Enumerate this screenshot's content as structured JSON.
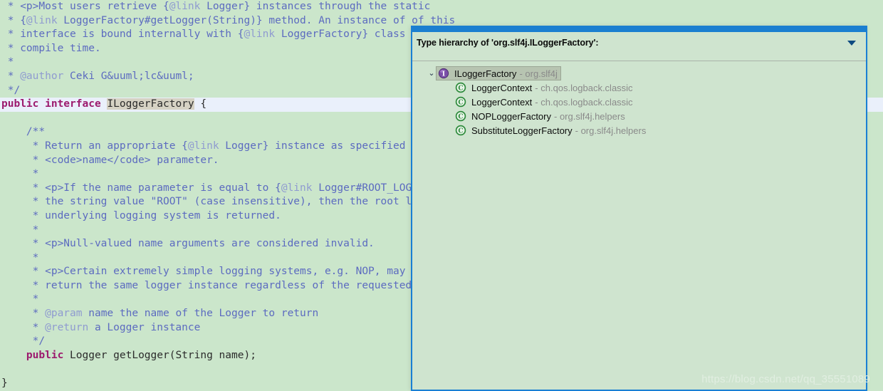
{
  "colors": {
    "editor_background": "#cbe6cb",
    "comment": "#5c6bc0",
    "comment_tag": "#8f9bd0",
    "keyword": "#9c1a6e",
    "current_line": "#eaf0fb",
    "occurrence_highlight": "#d6d2c4",
    "popup_border": "#1a7fd4",
    "popup_titlebar": "#1b7fd0",
    "popup_background": "#cfe4cf",
    "tree_selection": "#b7c4b1",
    "interface_icon": "#7b4fa8",
    "class_icon": "#2e8b3c",
    "package_text": "#8a8a8a"
  },
  "editor": {
    "lines": [
      {
        "type": "comment",
        "text": " * <p>Most users retrieve {@link Logger} instances through the static"
      },
      {
        "type": "comment",
        "text": " * {@link LoggerFactory#getLogger(String)} method. An instance of of this"
      },
      {
        "type": "comment",
        "text": " * interface is bound internally with {@link LoggerFactory} class at"
      },
      {
        "type": "comment",
        "text": " * compile time."
      },
      {
        "type": "comment",
        "text": " *"
      },
      {
        "type": "comment",
        "text": " * @author Ceki G&uuml;lc&uuml;"
      },
      {
        "type": "comment",
        "text": " */"
      },
      {
        "type": "declaration",
        "keyword": "public interface",
        "name": "ILoggerFactory",
        "brace": "{"
      },
      {
        "type": "blank",
        "text": ""
      },
      {
        "type": "comment",
        "text": "    /**"
      },
      {
        "type": "comment",
        "text": "     * Return an appropriate {@link Logger} instance as specified by the"
      },
      {
        "type": "comment",
        "text": "     * <code>name</code> parameter."
      },
      {
        "type": "comment",
        "text": "     *"
      },
      {
        "type": "comment",
        "text": "     * <p>If the name parameter is equal to {@link Logger#ROOT_LOGGER_NAME} or"
      },
      {
        "type": "comment",
        "text": "     * the string value \"ROOT\" (case insensitive), then the root logger of the"
      },
      {
        "type": "comment",
        "text": "     * underlying logging system is returned."
      },
      {
        "type": "comment",
        "text": "     *"
      },
      {
        "type": "comment",
        "text": "     * <p>Null-valued name arguments are considered invalid."
      },
      {
        "type": "comment",
        "text": "     *"
      },
      {
        "type": "comment",
        "text": "     * <p>Certain extremely simple logging systems, e.g. NOP, may always"
      },
      {
        "type": "comment",
        "text": "     * return the same logger instance regardless of the requested name."
      },
      {
        "type": "comment",
        "text": "     *"
      },
      {
        "type": "comment",
        "text": "     * @param name the name of the Logger to return"
      },
      {
        "type": "comment",
        "text": "     * @return a Logger instance"
      },
      {
        "type": "comment",
        "text": "     */"
      },
      {
        "type": "method",
        "text": "    public Logger getLogger(String name);"
      },
      {
        "type": "blank",
        "text": ""
      },
      {
        "type": "plain",
        "text": "}"
      }
    ]
  },
  "popup": {
    "title": "Type hierarchy of 'org.slf4j.ILoggerFactory':",
    "menu_icon": "chevron-down-icon",
    "tree": [
      {
        "name": "ILoggerFactory",
        "separator": "-",
        "package": "org.slf4j",
        "icon": "interface-icon",
        "depth": 0,
        "expanded": true,
        "twisty": "⌄",
        "selected": true
      },
      {
        "name": "LoggerContext",
        "separator": "-",
        "package": "ch.qos.logback.classic",
        "icon": "class-icon",
        "depth": 1,
        "expanded": false,
        "twisty": "",
        "selected": false
      },
      {
        "name": "LoggerContext",
        "separator": "-",
        "package": "ch.qos.logback.classic",
        "icon": "class-icon",
        "depth": 1,
        "expanded": false,
        "twisty": "",
        "selected": false
      },
      {
        "name": "NOPLoggerFactory",
        "separator": "-",
        "package": "org.slf4j.helpers",
        "icon": "class-icon",
        "depth": 1,
        "expanded": false,
        "twisty": "",
        "selected": false
      },
      {
        "name": "SubstituteLoggerFactory",
        "separator": "-",
        "package": "org.slf4j.helpers",
        "icon": "class-icon",
        "depth": 1,
        "expanded": false,
        "twisty": "",
        "selected": false
      }
    ]
  },
  "watermark": {
    "text": "https://blog.csdn.net/qq_35551089"
  }
}
